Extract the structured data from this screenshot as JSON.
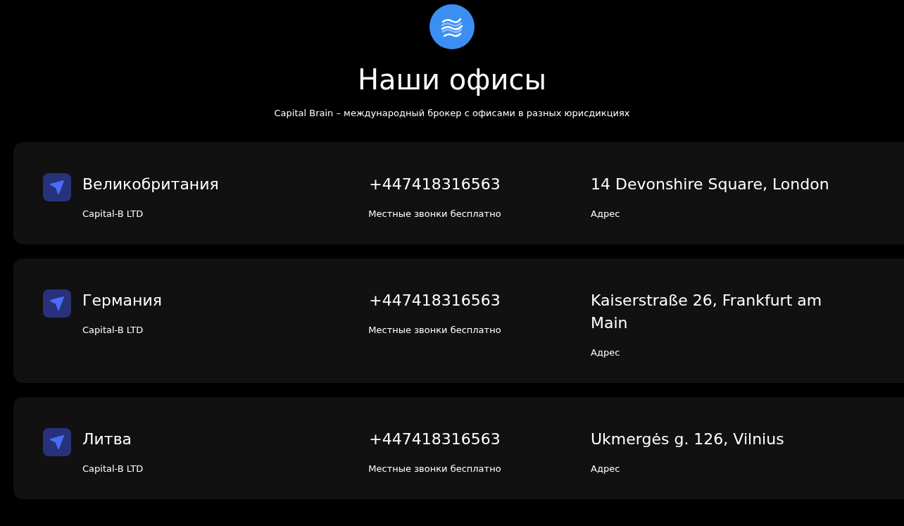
{
  "header": {
    "title": "Наши офисы",
    "subtitle": "Capital Brain – международный брокер с офисами в разных юрисдикциях"
  },
  "offices": [
    {
      "country": "Великобритания",
      "company": "Capital-B LTD",
      "phone": "+447418316563",
      "phone_note": "Местные звонки бесплатно",
      "address": "14 Devonshire Square, London",
      "address_label": "Адрес"
    },
    {
      "country": "Германия",
      "company": "Capital-B LTD",
      "phone": "+447418316563",
      "phone_note": "Местные звонки бесплатно",
      "address": "Kaiserstraße 26, Frankfurt am Main",
      "address_label": "Адрес"
    },
    {
      "country": "Литва",
      "company": "Capital-B LTD",
      "phone": "+447418316563",
      "phone_note": "Местные звонки бесплатно",
      "address": "Ukmergės g. 126, Vilnius",
      "address_label": "Адрес"
    }
  ]
}
